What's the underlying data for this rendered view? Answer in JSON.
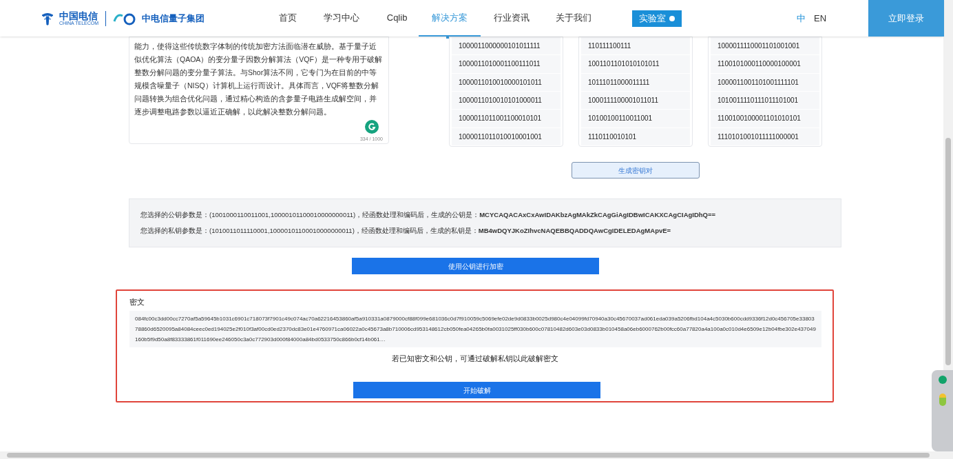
{
  "header": {
    "brand": "中国电信",
    "brand_en": "CHINA TELECOM",
    "group": "中电信量子集团",
    "nav": [
      {
        "label": "首页",
        "selected": false
      },
      {
        "label": "学习中心",
        "selected": false
      },
      {
        "label": "Cqlib",
        "selected": false
      },
      {
        "label": "解决方案",
        "selected": true
      },
      {
        "label": "行业资讯",
        "selected": false
      },
      {
        "label": "关于我们",
        "selected": false
      }
    ],
    "lab_button": "实验室",
    "languages": [
      {
        "label": "中",
        "selected": true
      },
      {
        "label": "EN",
        "selected": false
      }
    ],
    "login_button": "立即登录"
  },
  "intro": {
    "text": "能力，使得这些传统数字体制的传统加密方法面临潜在威胁。基于量子近似优化算法（QAOA）的变分量子因数分解算法（VQF）是一种专用于破解整数分解问题的变分量子算法。与Shor算法不同，它专门为在目前的中等规模含噪量子（NISQ）计算机上运行而设计。具体而言，VQF将整数分解问题转换为组合优化问题，通过精心构造的含参量子电路生成解空间，并逐步调整电路参数以逼近正确解，以此解决整数分解问题。",
    "counter": "334 / 1000"
  },
  "binary_columns": [
    [
      "1000011000000101011111",
      "1000011010001100111011",
      "1000011010010000101011",
      "1000011010010101000011",
      "1000011011001100010101",
      "1000011011010010001001"
    ],
    [
      "110111100111",
      "1001101101010101011",
      "10111011000011111",
      "1000111100001011011",
      "10100100110011001",
      "1110110010101"
    ],
    [
      "1000011110001101001001",
      "1100101000110000100001",
      "1000011001101001111101",
      "1010011110111011101001",
      "1100100100001101010101",
      "1110101001011111000001"
    ]
  ],
  "generate_button": "生成密钥对",
  "keys": [
    "您选择的公钥参数是：(1001000110011001,10000101100010000000011)，经函数处理和编码后，生成的公钥是：**MCYCAQACAxCxAwIDAKbzAgMAkZkCAgGiAgIDBwICAKXCAgCIAgIDhQ==**",
    "您选择的私钥参数是：(1010011011110001,10000101100010000000011)，经函数处理和编码后，生成的私钥是：**MB4wDQYJKoZIhvcNAQEBBQADDQAwCgIDELEDAgMApvE=**"
  ],
  "encrypt_button": "使用公钥进行加密",
  "cipher": {
    "label": "密文",
    "text": "084fc00c3dd00cc7270af5a59645b1031c6901c718073f7901c49c074ac70a62216453860af5a910331a0879000cf88f099e681036c0d7f910059c5069efe02de9d0833b0025d980c4e04099fd70940a30c45670037ad061eda039a5206fbd104a4c5030b600cdd9336f12d0c456705e3380378860d6520095a84084ceec0ed194025e2f010f3af00cd0ed2370dc83e01e4760971ca06022a0c45673a8b710006cd953148612cb050fea04265b0fa0031025ff030b600c07810482d603e03d0833b010458a06eb6000762b00fcc60a77820a4a100a0c010d4e6509e12b04fbe302e437049160b5f9d50a8f83333861f011690ee246050c3a0c772903d000f84000a84bd0533750c866b0cf14b061…",
    "hint": "若已知密文和公钥，可通过破解私钥以此破解密文",
    "decrypt_button": "开始破解"
  }
}
